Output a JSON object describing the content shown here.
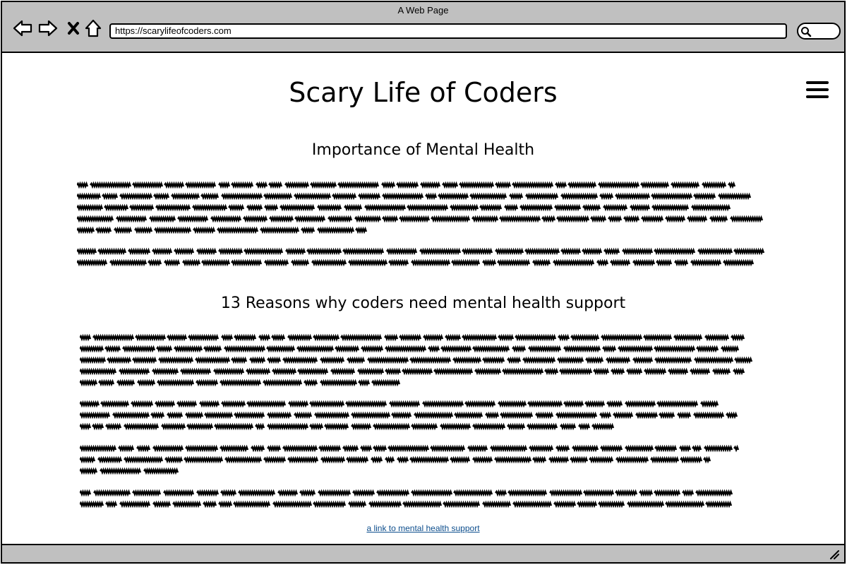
{
  "browser": {
    "window_title": "A Web Page",
    "url": "https://scarylifeofcoders.com",
    "icons": [
      "back-arrow-icon",
      "forward-arrow-icon",
      "close-icon",
      "home-icon",
      "search-icon"
    ]
  },
  "page": {
    "title": "Scary Life of Coders",
    "menu_icon": "hamburger-icon",
    "section1": {
      "heading": "Importance of Mental Health",
      "paragraphs": [
        {
          "lines": [
            0.95,
            0.98,
            0.95,
            0.99,
            0.42
          ]
        },
        {
          "lines": [
            0.99,
            0.98
          ]
        }
      ]
    },
    "section2": {
      "heading": "13 Reasons why coders need mental health support",
      "paragraphs": [
        {
          "lines": [
            0.96,
            0.95,
            0.97,
            0.96,
            0.47
          ]
        },
        {
          "lines": [
            0.92,
            0.95,
            0.77
          ]
        },
        {
          "lines": [
            0.95,
            0.91,
            0.14
          ]
        },
        {
          "lines": [
            0.94,
            0.94
          ]
        }
      ]
    },
    "link_text": "a link to mental health support"
  },
  "colors": {
    "chrome": "#c0c0c0",
    "link": "#0d4e8d"
  }
}
